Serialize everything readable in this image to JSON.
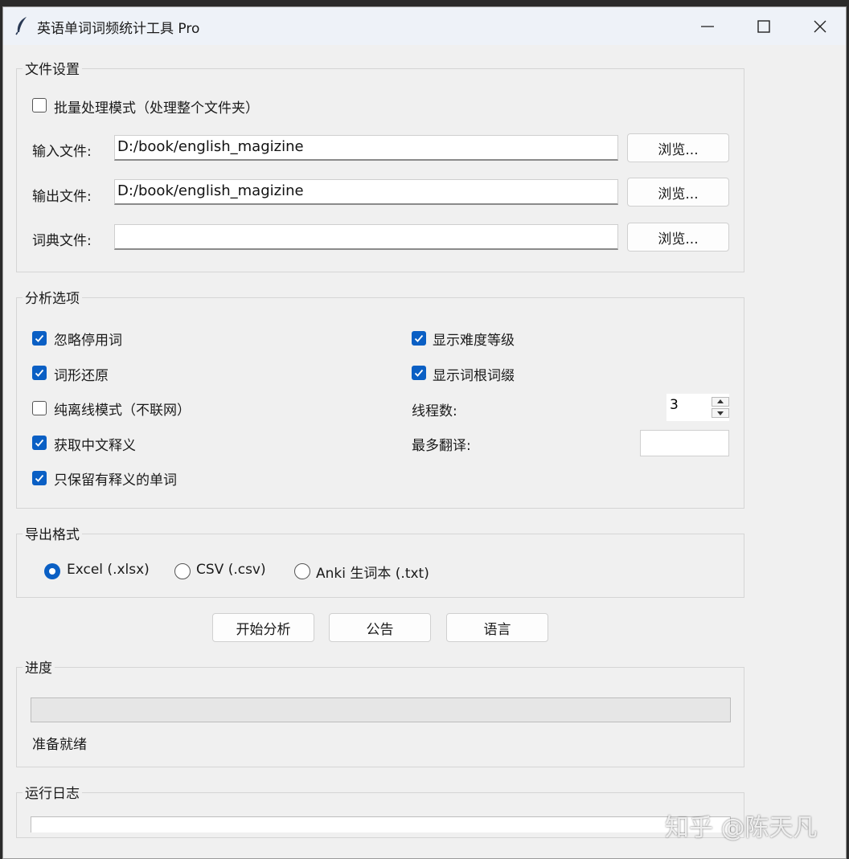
{
  "window": {
    "title": "英语单词词频统计工具 Pro",
    "app_icon": "feather-icon"
  },
  "file_settings": {
    "group_title": "文件设置",
    "batch_mode_label": "批量处理模式（处理整个文件夹）",
    "batch_mode_checked": false,
    "input_label": "输入文件:",
    "input_value": "D:/book/english_magizine",
    "output_label": "输出文件:",
    "output_value": "D:/book/english_magizine",
    "dict_label": "词典文件:",
    "dict_value": "",
    "browse_label": "浏览..."
  },
  "analysis_options": {
    "group_title": "分析选项",
    "left": [
      {
        "label": "忽略停用词",
        "checked": true
      },
      {
        "label": "词形还原",
        "checked": true
      },
      {
        "label": "纯离线模式（不联网）",
        "checked": false
      },
      {
        "label": "获取中文释义",
        "checked": true
      },
      {
        "label": "只保留有释义的单词",
        "checked": true
      }
    ],
    "right": [
      {
        "label": "显示难度等级",
        "checked": true
      },
      {
        "label": "显示词根词缀",
        "checked": true
      }
    ],
    "threads_label": "线程数:",
    "threads_value": "3",
    "max_translate_label": "最多翻译:",
    "max_translate_value": ""
  },
  "export_format": {
    "group_title": "导出格式",
    "options": [
      {
        "label": "Excel (.xlsx)",
        "selected": true
      },
      {
        "label": "CSV (.csv)",
        "selected": false
      },
      {
        "label": "Anki 生词本 (.txt)",
        "selected": false
      }
    ]
  },
  "actions": {
    "start": "开始分析",
    "notice": "公告",
    "language": "语言"
  },
  "progress": {
    "group_title": "进度",
    "value": 0,
    "status": "准备就绪"
  },
  "log": {
    "group_title": "运行日志"
  },
  "watermark": "知乎 @陈天凡",
  "colors": {
    "accent": "#0a5fc4",
    "window_bg": "#f0f0f0",
    "titlebar_bg": "#eef2f8"
  }
}
